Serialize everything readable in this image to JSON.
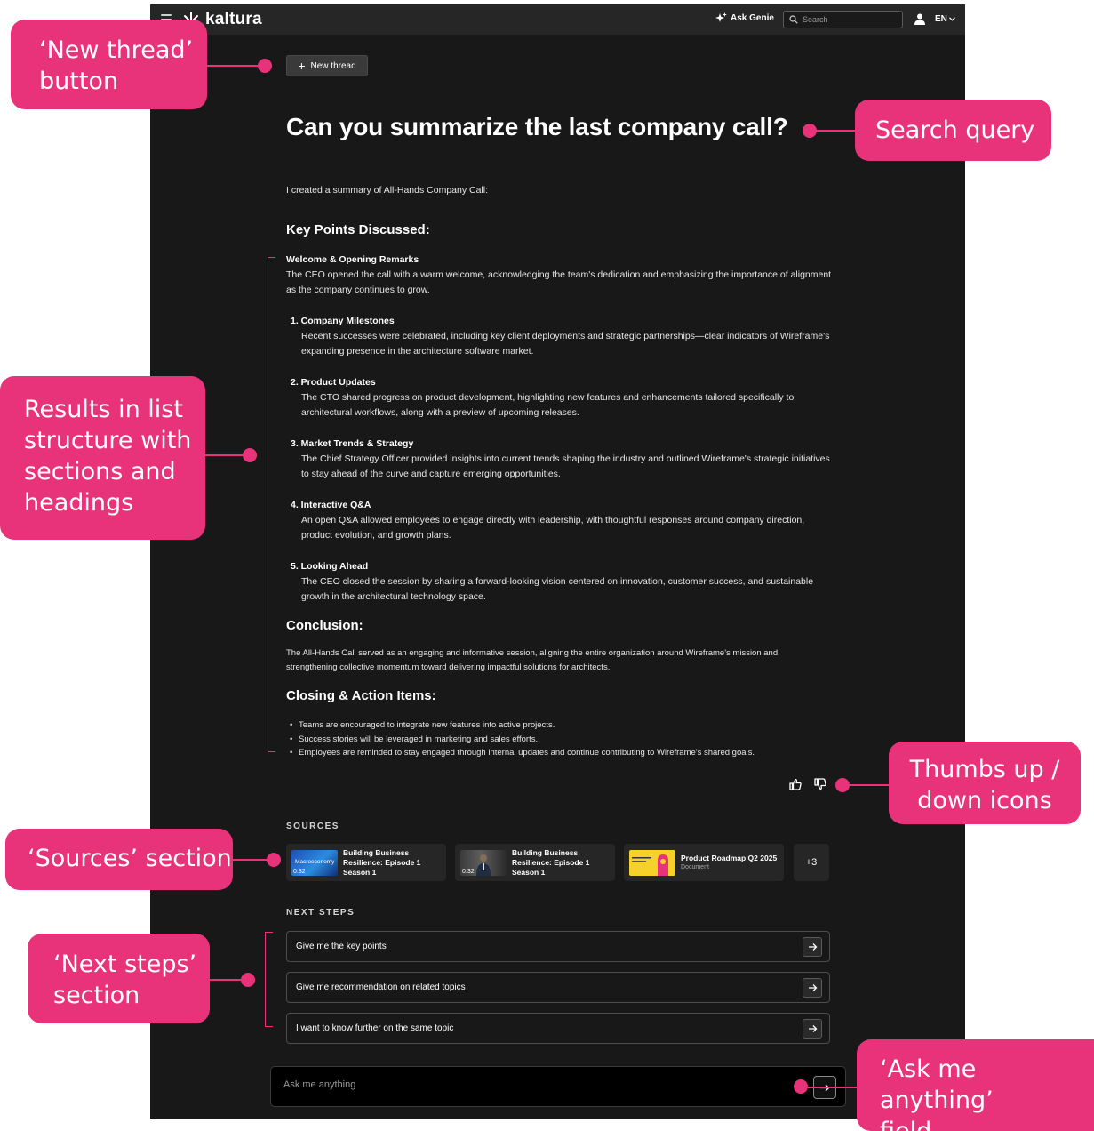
{
  "topbar": {
    "logo_text": "kaltura",
    "ask_genie_label": "Ask Genie",
    "search_placeholder": "Search",
    "language": "EN"
  },
  "thread": {
    "new_thread_label": "New thread",
    "query": "Can you summarize the last company call?",
    "intro": "I created a summary of All-Hands Company Call:",
    "key_points_heading": "Key Points Discussed:",
    "welcome": {
      "title": "Welcome & Opening Remarks",
      "body": "The CEO opened the call with a warm welcome, acknowledging the team's dedication and emphasizing the importance of alignment as the company continues to grow."
    },
    "items": [
      {
        "title": "1. Company Milestones",
        "body": "Recent successes were celebrated, including key client deployments and strategic partnerships—clear indicators of Wireframe's expanding presence in the architecture software market."
      },
      {
        "title": "2. Product Updates",
        "body": "The CTO shared progress on product development, highlighting new features and enhancements tailored specifically to architectural workflows, along with a preview of upcoming releases."
      },
      {
        "title": "3. Market Trends & Strategy",
        "body": "The Chief Strategy Officer provided insights into current trends shaping the industry and outlined Wireframe's strategic initiatives to stay ahead of the curve and capture emerging opportunities."
      },
      {
        "title": "4. Interactive Q&A",
        "body": "An open Q&A allowed employees to engage directly with leadership, with thoughtful responses around company direction, product evolution, and growth plans."
      },
      {
        "title": "5. Looking Ahead",
        "body": "The CEO closed the session by sharing a forward-looking vision centered on innovation, customer success, and sustainable growth in the architectural technology space."
      }
    ],
    "conclusion_heading": "Conclusion:",
    "conclusion_body": "The All-Hands Call served as an engaging and informative session, aligning the entire organization around Wireframe's mission and strengthening collective momentum toward delivering impactful solutions for architects.",
    "closing_heading": "Closing & Action Items:",
    "closing_items": [
      "Teams are encouraged to integrate new features into active projects.",
      "Success stories will be leveraged in marketing and sales efforts.",
      "Employees are reminded to stay engaged through internal updates and continue contributing to Wireframe's shared goals."
    ]
  },
  "sources": {
    "label": "SOURCES",
    "cards": [
      {
        "title": "Building Business Resilience: Episode 1 Season 1",
        "duration": "0:32",
        "thumb_text": "Macroeconomy"
      },
      {
        "title": "Building Business Resilience: Episode 1 Season 1",
        "duration": "0:32"
      },
      {
        "title": "Product Roadmap Q2 2025",
        "subtitle": "Document"
      }
    ],
    "more": "+3"
  },
  "next_steps": {
    "label": "NEXT STEPS",
    "items": [
      "Give me the key points",
      "Give me recommendation on related topics",
      "I want to know further on the same topic"
    ]
  },
  "ask": {
    "placeholder": "Ask me anything"
  },
  "annotations": {
    "new_thread": [
      "‘New thread’",
      "button"
    ],
    "search_query": [
      "Search  query"
    ],
    "results": [
      "Results in list",
      "structure with",
      "sections and",
      "headings"
    ],
    "thumbs": [
      "Thumbs up /",
      "down icons"
    ],
    "sources": [
      "‘Sources’ section"
    ],
    "next_steps": [
      "‘Next steps’",
      "section"
    ],
    "ask_field": [
      "‘Ask me anything’",
      "field"
    ]
  },
  "colors": {
    "annotation": "#e8337a",
    "app_background": "#181818",
    "topbar": "#262626"
  }
}
